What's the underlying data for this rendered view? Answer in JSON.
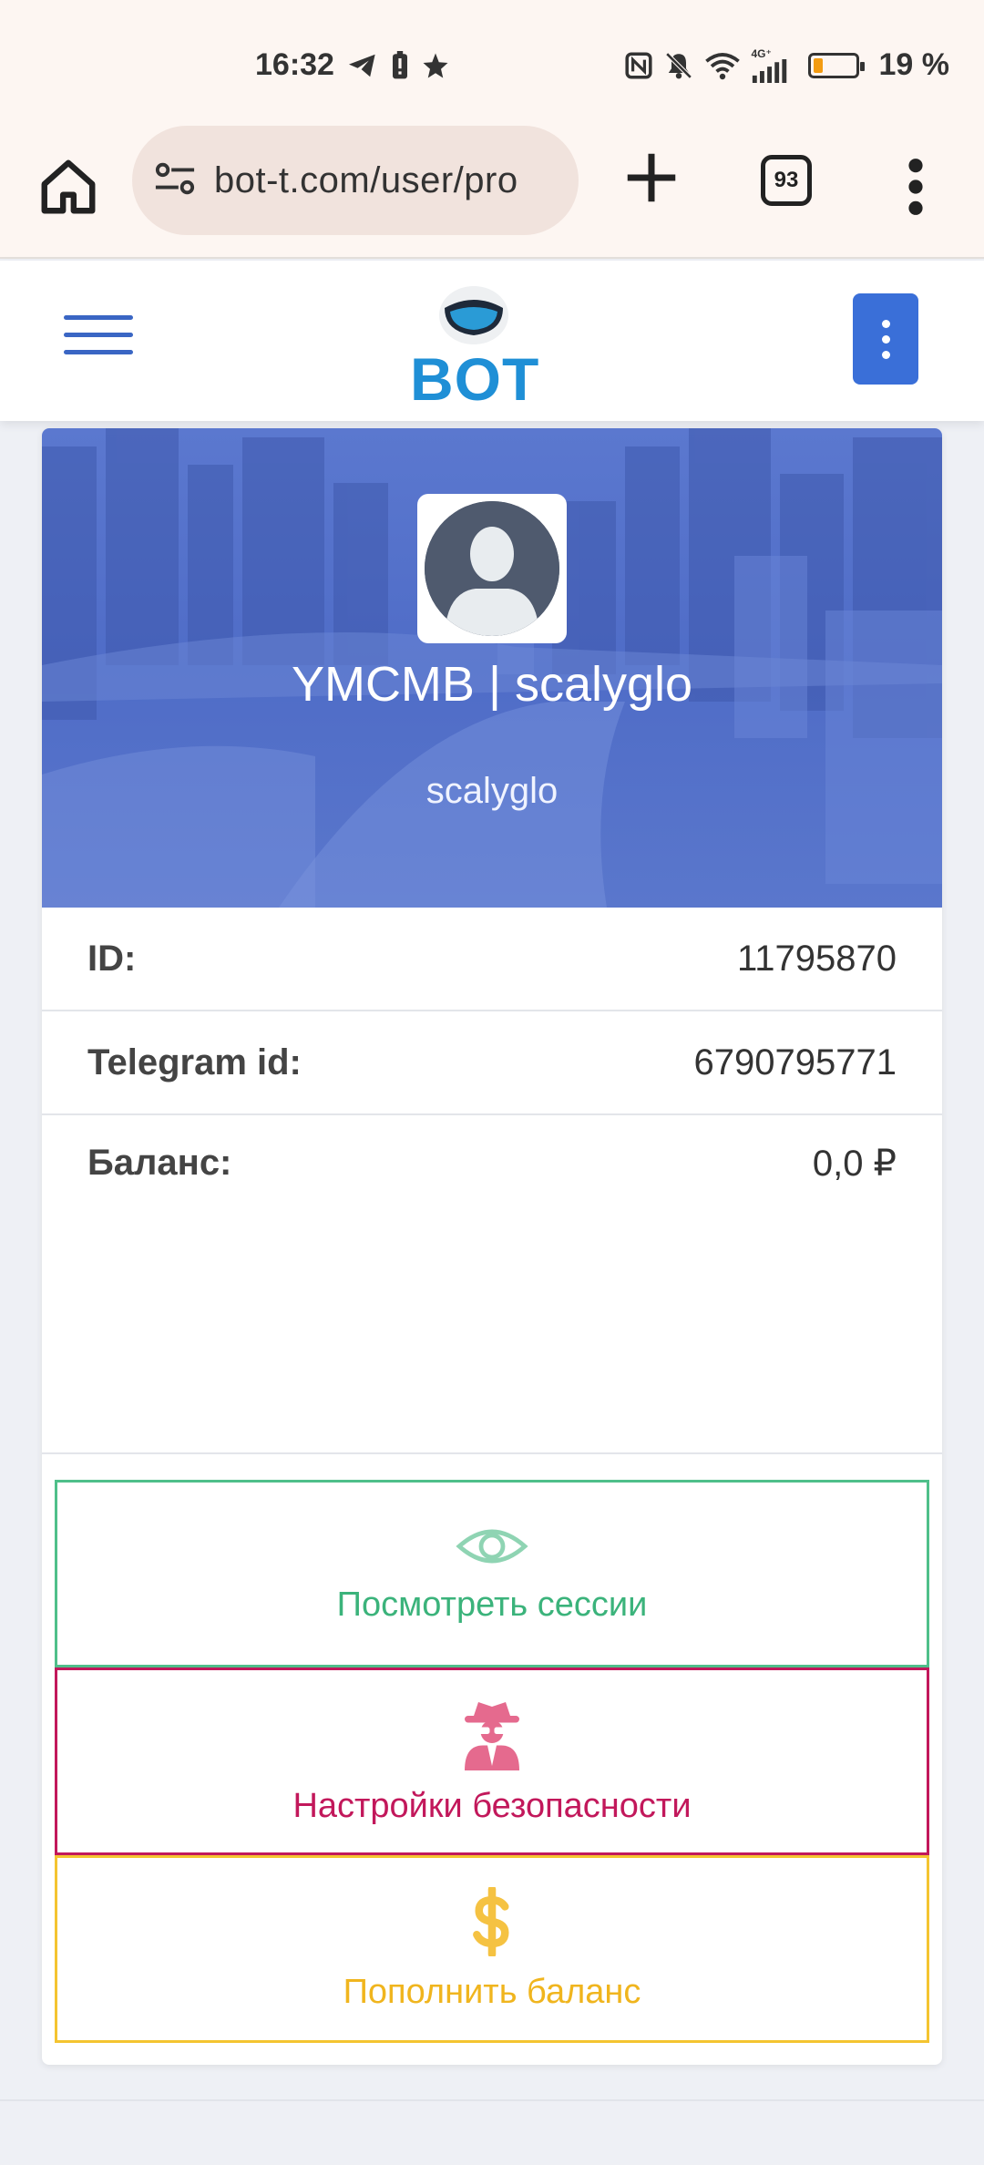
{
  "status_bar": {
    "time": "16:32",
    "battery": "19 %",
    "network": "4G⁺"
  },
  "browser": {
    "url": "bot-t.com/user/pro",
    "tab_count": "93"
  },
  "app": {
    "logo_text": "BOT"
  },
  "profile": {
    "display_name": "YMCMB | scalyglo",
    "username": "scalyglo"
  },
  "info": {
    "id_label": "ID:",
    "id_value": "11795870",
    "tg_label": "Telegram id:",
    "tg_value": "6790795771",
    "balance_label": "Баланс:",
    "balance_value": "0,0 ₽"
  },
  "actions": {
    "sessions": "Посмотреть сессии",
    "security": "Настройки безопасности",
    "topup": "Пополнить баланс"
  },
  "colors": {
    "sessions": "#3bb37b",
    "security": "#c2185b",
    "topup": "#f0b51e",
    "accent": "#3a6fd8"
  }
}
